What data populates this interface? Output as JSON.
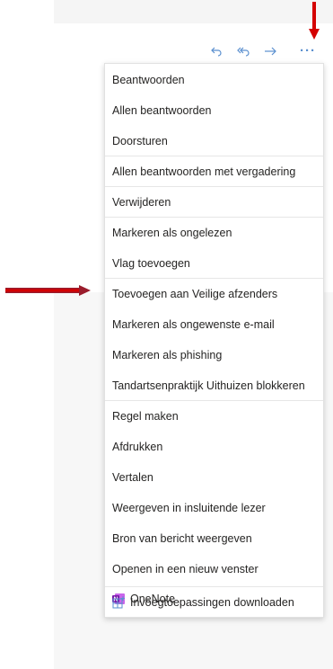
{
  "colors": {
    "accent": "#5a8fcf",
    "arrow": "#d40000",
    "onenote": "#7719aa"
  },
  "toolbar": {
    "reply_icon": "reply-icon",
    "reply_all_icon": "reply-all-icon",
    "forward_icon": "forward-icon",
    "more_label": "···"
  },
  "menu": {
    "items": [
      "Beantwoorden",
      "Allen beantwoorden",
      "Doorsturen",
      "Allen beantwoorden met vergadering",
      "Verwijderen",
      "Markeren als ongelezen",
      "Vlag toevoegen",
      "Toevoegen aan Veilige afzenders",
      "Markeren als ongewenste e-mail",
      "Markeren als phishing",
      "Tandartsenpraktijk Uithuizen blokkeren",
      "Regel maken",
      "Afdrukken",
      "Vertalen",
      "Weergeven in insluitende lezer",
      "Bron van bericht weergeven",
      "Openen in een nieuw venster",
      "OneNote",
      "Invoegtoepassingen downloaden"
    ]
  }
}
